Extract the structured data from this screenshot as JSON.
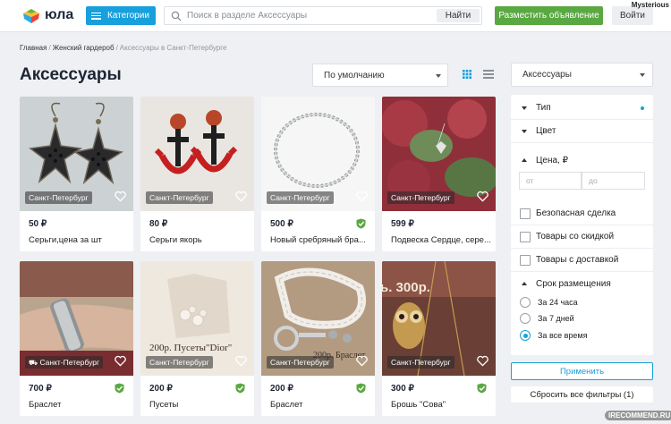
{
  "header": {
    "logo_text": "юла",
    "categories_label": "Категории",
    "search_placeholder": "Поиск в разделе Аксессуары",
    "search_button": "Найти",
    "post_button": "Разместить объявление",
    "login_button": "Войти",
    "user_name": "Mysterious"
  },
  "breadcrumb": {
    "items": [
      "Главная",
      "Женский гардероб",
      "Аксессуары в Санкт-Петербурге"
    ],
    "separator": "/"
  },
  "page": {
    "title": "Аксессуары",
    "sort_value": "По умолчанию"
  },
  "products": [
    {
      "location": "Санкт-Петербург",
      "price": "50 ₽",
      "title": "Серьги,цена за шт",
      "verified": false
    },
    {
      "location": "Санкт-Петербург",
      "price": "80 ₽",
      "title": "Серьги якорь",
      "verified": false
    },
    {
      "location": "Санкт-Петербург",
      "price": "500 ₽",
      "title": "Новый сребряный бра...",
      "verified": true
    },
    {
      "location": "Санкт-Петербург",
      "price": "599 ₽",
      "title": "Подвеска Сердце, сере...",
      "verified": false
    },
    {
      "location": "Санкт-Петербург",
      "price": "700 ₽",
      "title": "Браслет",
      "verified": true,
      "delivery": true
    },
    {
      "location": "Санкт-Петербург",
      "price": "200 ₽",
      "title": "Пусеты",
      "verified": true,
      "image_text": "200р. Пусеты\"Dior\""
    },
    {
      "location": "Санкт-Петербург",
      "price": "200 ₽",
      "title": "Браслет",
      "verified": true,
      "image_text": "200р. Браслет"
    },
    {
      "location": "Санкт-Петербург",
      "price": "300 ₽",
      "title": "Брошь \"Сова\"",
      "verified": true,
      "image_text": "ь. 300р."
    }
  ],
  "sidebar": {
    "category_value": "Аксессуары",
    "filters": {
      "type": "Тип",
      "color": "Цвет",
      "price": "Цена, ₽",
      "price_from": "от",
      "price_to": "до",
      "safe_deal": "Безопасная сделка",
      "discount": "Товары со скидкой",
      "delivery": "Товары с доставкой",
      "period": "Срок размещения",
      "periods": [
        "За 24 часа",
        "За 7 дней",
        "За все время"
      ],
      "selected_period": "За все время"
    },
    "apply": "Применить",
    "reset": "Сбросить все фильтры (1)"
  },
  "watermark": "IRECOMMEND.RU",
  "colors": {
    "accent": "#17a0dc",
    "post_green": "#5aa842",
    "verified_green": "#5aa842"
  }
}
